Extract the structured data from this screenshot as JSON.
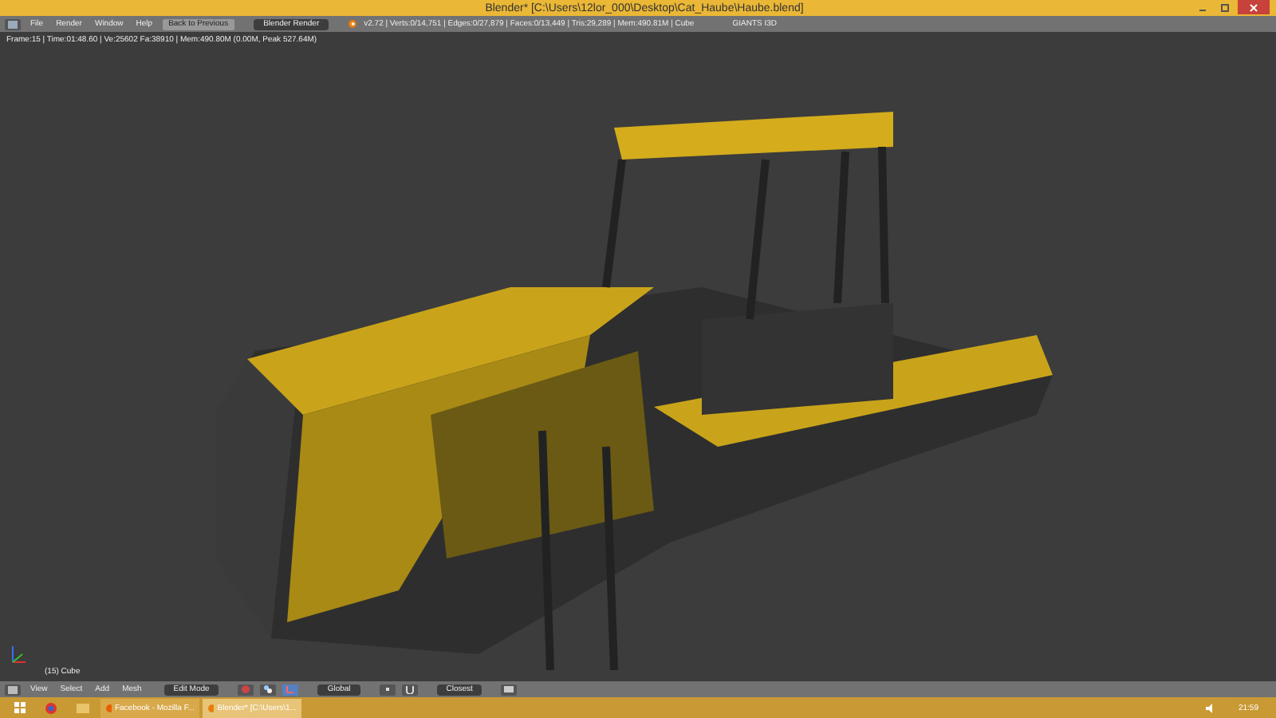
{
  "window": {
    "title": "Blender* [C:\\Users\\12lor_000\\Desktop\\Cat_Haube\\Haube.blend]"
  },
  "top_header": {
    "menus": [
      "File",
      "Render",
      "Window",
      "Help"
    ],
    "back_button": "Back to Previous",
    "render_engine": "Blender Render",
    "stats": "v2.72 | Verts:0/14,751 | Edges:0/27,879 | Faces:0/13,449 | Tris:29,289 | Mem:490.81M | Cube",
    "scene_label": "GIANTS I3D"
  },
  "viewport": {
    "info": "Frame:15 | Time:01:48.60 | Ve:25602 Fa:38910 | Mem:490.80M (0.00M, Peak 527.64M)",
    "object_label": "(15) Cube"
  },
  "bottom_header": {
    "menus": [
      "View",
      "Select",
      "Add",
      "Mesh"
    ],
    "mode": "Edit Mode",
    "orientation": "Global",
    "snap": "Closest"
  },
  "taskbar": {
    "items": [
      {
        "label": "Facebook - Mozilla F...",
        "selected": false
      },
      {
        "label": "Blender* [C:\\Users\\1...",
        "selected": true
      }
    ],
    "clock": "21:59"
  }
}
